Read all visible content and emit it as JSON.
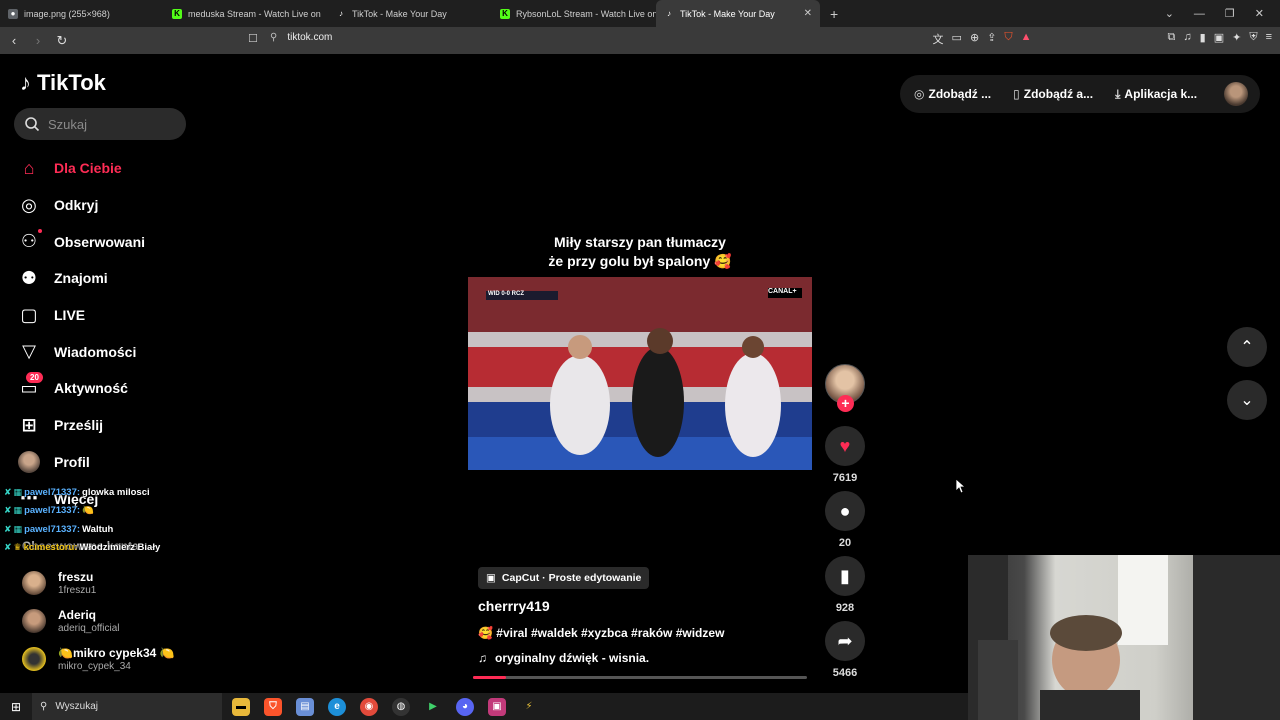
{
  "browser": {
    "tabs": [
      {
        "title": "image.png (255×968)",
        "icon": "globe-icon",
        "color": "#9aa0a6"
      },
      {
        "title": "meduska Stream - Watch Live on",
        "icon": "kick-icon",
        "color": "#53fc18"
      },
      {
        "title": "TikTok - Make Your Day",
        "icon": "tiktok-icon",
        "color": "#ffffff"
      },
      {
        "title": "RybsonLoL Stream - Watch Live on K",
        "icon": "kick-icon",
        "color": "#53fc18"
      },
      {
        "title": "TikTok - Make Your Day",
        "icon": "tiktok-icon",
        "color": "#ffffff",
        "active": true
      }
    ],
    "url": "tiktok.com"
  },
  "sidebar": {
    "logo_text": "TikTok",
    "search_placeholder": "Szukaj",
    "nav": [
      {
        "label": "Dla Ciebie",
        "icon": "home-icon"
      },
      {
        "label": "Odkryj",
        "icon": "compass-icon"
      },
      {
        "label": "Obserwowani",
        "icon": "following-icon"
      },
      {
        "label": "Znajomi",
        "icon": "friends-icon"
      },
      {
        "label": "LIVE",
        "icon": "live-icon"
      },
      {
        "label": "Wiadomości",
        "icon": "messages-icon"
      },
      {
        "label": "Aktywność",
        "icon": "activity-icon",
        "badge": "20"
      },
      {
        "label": "Prześlij",
        "icon": "upload-icon"
      },
      {
        "label": "Profil",
        "icon": "profile-icon"
      },
      {
        "label": "Więcej",
        "icon": "more-icon"
      }
    ],
    "followed_title": "Obserwowane konta",
    "followed": [
      {
        "name": "freszu",
        "handle": "1freszu1"
      },
      {
        "name": "Aderiq",
        "handle": "aderiq_official"
      },
      {
        "name": "🍋mikro cypek34 🍋",
        "handle": "mikro_cypek_34"
      }
    ]
  },
  "chat": [
    {
      "user": "pawel71337:",
      "msg": "glowka milosci",
      "color": "#5ab2ff"
    },
    {
      "user": "pawel71337:",
      "msg": "🍋",
      "color": "#5ab2ff"
    },
    {
      "user": "pawel71337:",
      "msg": "Waltuh",
      "color": "#5ab2ff"
    },
    {
      "user": "kcimestoru:",
      "msg": "Włodzimierz Biały",
      "color": "#f0c419"
    }
  ],
  "top_actions": [
    {
      "label": "Zdobądź ...",
      "icon": "coin-icon"
    },
    {
      "label": "Zdobądź a...",
      "icon": "phone-icon"
    },
    {
      "label": "Aplikacja k...",
      "icon": "download-icon"
    }
  ],
  "video": {
    "caption_line1": "Miły starszy pan tłumaczy",
    "caption_line2": "że przy golu był spalony 🥰",
    "overlay_scoreboard": "WID 0-0 RCZ",
    "overlay_channel": "CANAL+",
    "capcut_label": "CapCut · Proste edytowanie",
    "author": "cherrry419",
    "tags": "🥰 #viral #waldek #xyzbca #raków #widzew",
    "sound": "oryginalny dźwięk - wisnia.",
    "progress": 0.1
  },
  "rail": {
    "likes": "7619",
    "comments": "20",
    "saves": "928",
    "shares": "5466"
  },
  "taskbar": {
    "search_placeholder": "Wyszukaj"
  },
  "colors": {
    "accent": "#fe2c55",
    "background": "#000000"
  }
}
